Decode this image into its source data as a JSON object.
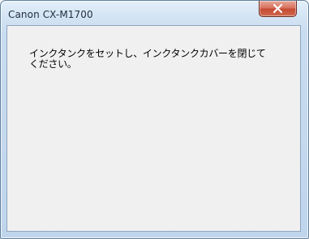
{
  "window": {
    "title": "Canon CX-M1700",
    "close_icon": "close-x-icon"
  },
  "dialog": {
    "message": "インクタンクをセットし、インクタンクカバーを閉じて\nください。"
  },
  "colors": {
    "close_button": "#d06a4e",
    "frame": "#c9dcf0",
    "client_background": "#f0f0f0"
  }
}
